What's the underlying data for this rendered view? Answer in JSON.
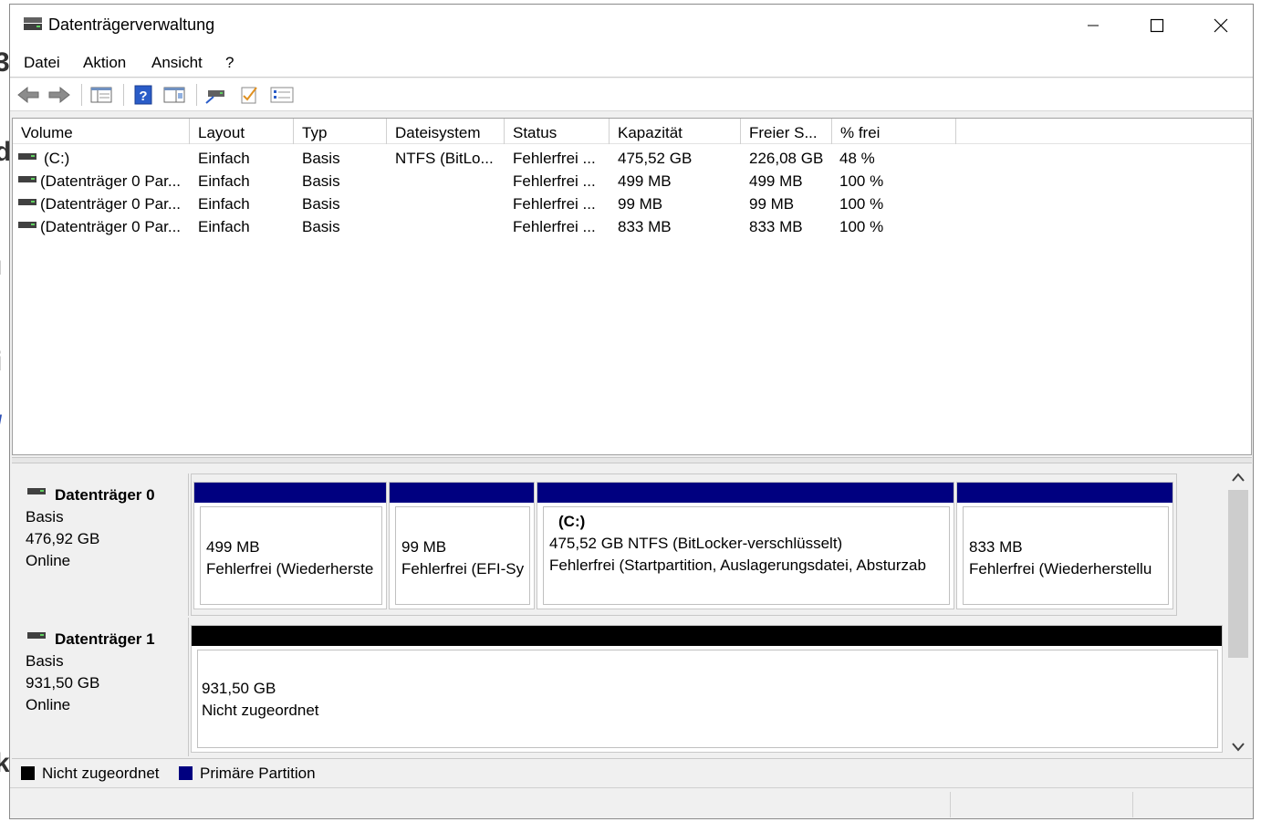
{
  "window": {
    "title": "Datenträgerverwaltung"
  },
  "menu": [
    "Datei",
    "Aktion",
    "Ansicht",
    "?"
  ],
  "toolbar_icons": [
    "back-arrow-icon",
    "forward-arrow-icon",
    "console-tree-icon",
    "help-icon",
    "properties-icon",
    "connect-icon",
    "checklist-icon",
    "settings-list-icon"
  ],
  "columns": [
    "Volume",
    "Layout",
    "Typ",
    "Dateisystem",
    "Status",
    "Kapazität",
    "Freier S...",
    "% frei"
  ],
  "volumes": [
    {
      "volume": "(C:)",
      "layout": "Einfach",
      "typ": "Basis",
      "fs": "NTFS (BitLo...",
      "status": "Fehlerfrei ...",
      "cap": "475,52 GB",
      "free": "226,08 GB",
      "pct": "48 %"
    },
    {
      "volume": "(Datenträger 0 Par...",
      "layout": "Einfach",
      "typ": "Basis",
      "fs": "",
      "status": "Fehlerfrei ...",
      "cap": "499 MB",
      "free": "499 MB",
      "pct": "100 %"
    },
    {
      "volume": "(Datenträger 0 Par...",
      "layout": "Einfach",
      "typ": "Basis",
      "fs": "",
      "status": "Fehlerfrei ...",
      "cap": "99 MB",
      "free": "99 MB",
      "pct": "100 %"
    },
    {
      "volume": "(Datenträger 0 Par...",
      "layout": "Einfach",
      "typ": "Basis",
      "fs": "",
      "status": "Fehlerfrei ...",
      "cap": "833 MB",
      "free": "833 MB",
      "pct": "100 %"
    }
  ],
  "disks": [
    {
      "name": "Datenträger 0",
      "type": "Basis",
      "size": "476,92 GB",
      "state": "Online",
      "partitions": [
        {
          "title": "",
          "size": "499 MB",
          "status": "Fehlerfrei (Wiederherste"
        },
        {
          "title": "",
          "size": "99 MB",
          "status": "Fehlerfrei (EFI-Sy"
        },
        {
          "title": "(C:)",
          "size": "475,52 GB NTFS (BitLocker-verschlüsselt)",
          "status": "Fehlerfrei (Startpartition, Auslagerungsdatei, Absturzab"
        },
        {
          "title": "",
          "size": "833 MB",
          "status": "Fehlerfrei (Wiederherstellu"
        }
      ]
    },
    {
      "name": "Datenträger 1",
      "type": "Basis",
      "size": "931,50 GB",
      "state": "Online",
      "partitions": [
        {
          "size": "931,50 GB",
          "status": "Nicht zugeordnet"
        }
      ]
    }
  ],
  "legend": [
    {
      "label": "Nicht zugeordnet",
      "color": "#000000"
    },
    {
      "label": "Primäre Partition",
      "color": "#000080"
    }
  ],
  "colors": {
    "primary_partition": "#000080",
    "unallocated": "#000000"
  }
}
